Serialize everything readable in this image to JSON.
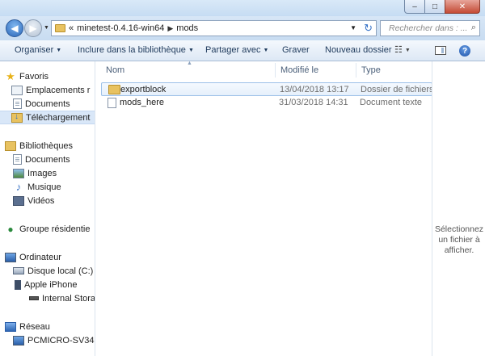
{
  "window": {
    "controls": [
      "–",
      "□",
      "✕"
    ]
  },
  "address": {
    "chevron": "«",
    "crumbs": [
      "minetest-0.4.16-win64",
      "mods"
    ],
    "search_placeholder": "Rechercher dans : ..."
  },
  "toolbar": {
    "organize": "Organiser",
    "include": "Inclure dans la bibliothèque",
    "share": "Partager avec",
    "burn": "Graver",
    "new_folder": "Nouveau dossier",
    "help": "?"
  },
  "sidebar": {
    "favorites": "Favoris",
    "emplacements": "Emplacements r",
    "documents_fav": "Documents",
    "telechargements": "Téléchargement",
    "bibliotheques": "Bibliothèques",
    "documents_lib": "Documents",
    "images": "Images",
    "musique": "Musique",
    "videos": "Vidéos",
    "groupe": "Groupe résidentie",
    "ordinateur": "Ordinateur",
    "disque": "Disque local (C:)",
    "iphone": "Apple iPhone",
    "internal": "Internal Storag",
    "reseau": "Réseau",
    "pcmicro": "PCMICRO-SV34"
  },
  "columns": {
    "name": "Nom",
    "modified": "Modifié le",
    "type": "Type"
  },
  "files": [
    {
      "name": "exportblock",
      "modified": "13/04/2018 13:17",
      "type": "Dossier de fichiers",
      "icon": "folder-icon"
    },
    {
      "name": "mods_here",
      "modified": "31/03/2018 14:31",
      "type": "Document texte",
      "icon": "text-file-icon"
    }
  ],
  "details": {
    "message_lines": [
      "Sélectionnez",
      "un fichier à",
      "afficher."
    ]
  }
}
